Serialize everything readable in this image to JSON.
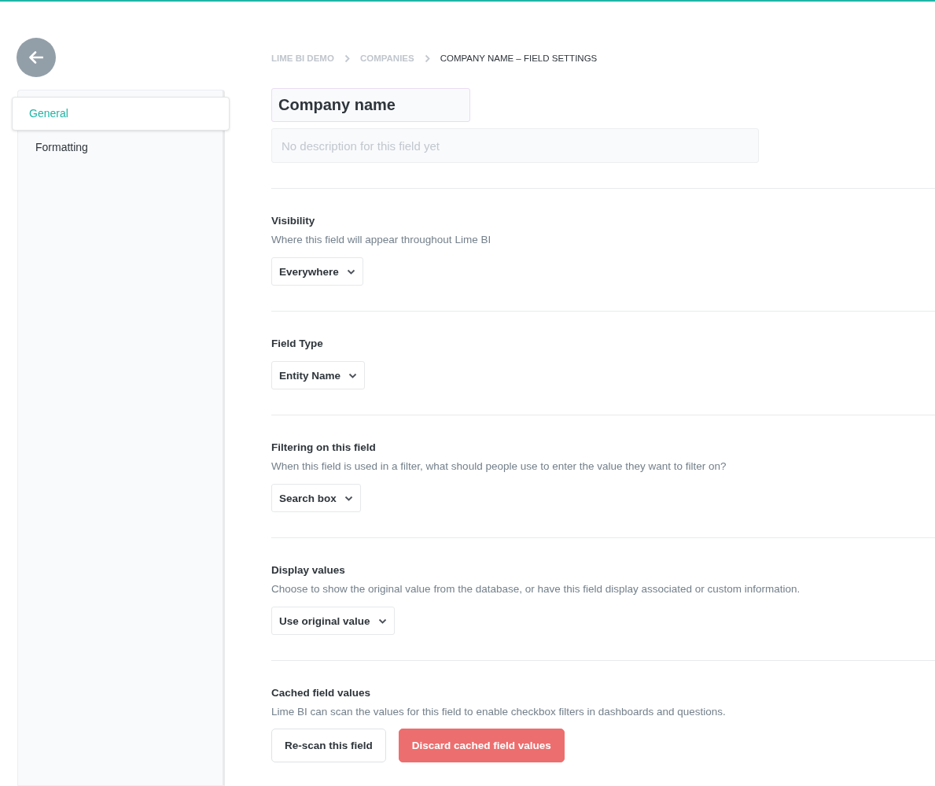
{
  "breadcrumb": [
    {
      "label": "LIME BI DEMO",
      "current": false
    },
    {
      "label": "COMPANIES",
      "current": false
    },
    {
      "label": "COMPANY NAME – FIELD SETTINGS",
      "current": true
    }
  ],
  "sidebar": {
    "items": [
      {
        "label": "General",
        "selected": true
      },
      {
        "label": "Formatting",
        "selected": false
      }
    ]
  },
  "field": {
    "name": "Company name",
    "description_placeholder": "No description for this field yet"
  },
  "sections": [
    {
      "kind": "select",
      "title": "Visibility",
      "description": "Where this field will appear throughout Lime BI",
      "value": "Everywhere"
    },
    {
      "kind": "select",
      "title": "Field Type",
      "value": "Entity Name"
    },
    {
      "kind": "select",
      "title": "Filtering on this field",
      "description": "When this field is used in a filter, what should people use to enter the value they want to filter on?",
      "value": "Search box"
    },
    {
      "kind": "select",
      "title": "Display values",
      "description": "Choose to show the original value from the database, or have this field display associated or custom information.",
      "value": "Use original value"
    },
    {
      "kind": "buttons",
      "title": "Cached field values",
      "description": "Lime BI can scan the values for this field to enable checkbox filters in dashboards and questions.",
      "buttons": [
        {
          "label": "Re-scan this field",
          "kind": "secondary"
        },
        {
          "label": "Discard cached field values",
          "kind": "danger"
        }
      ]
    }
  ]
}
